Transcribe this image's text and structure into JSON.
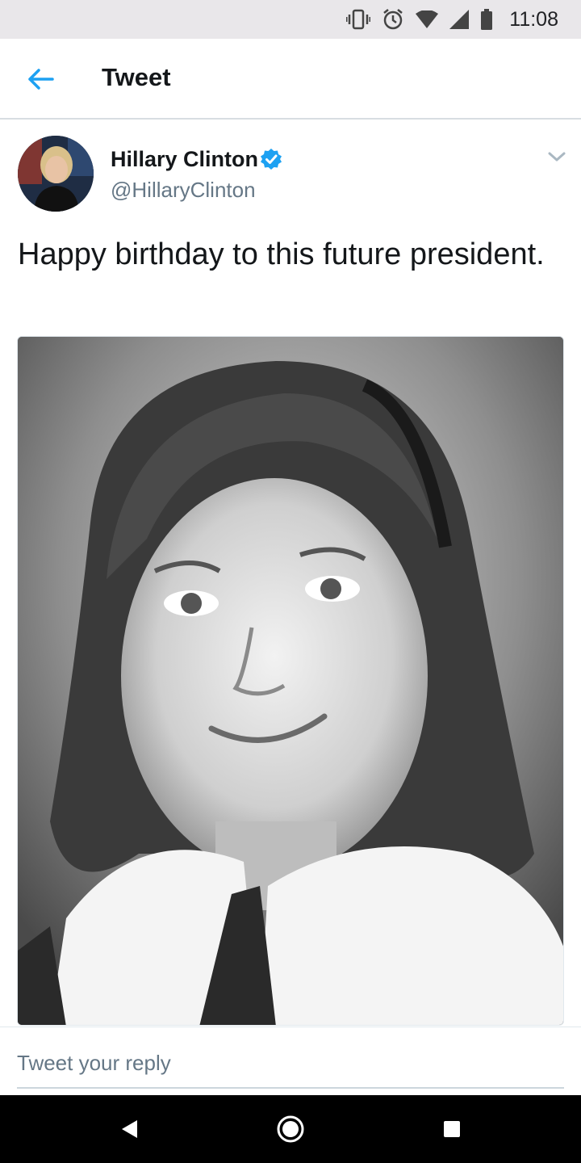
{
  "status_bar": {
    "time": "11:08",
    "icons": [
      "vibrate-icon",
      "alarm-icon",
      "wifi-icon",
      "signal-icon",
      "battery-icon"
    ]
  },
  "app_bar": {
    "back_icon": "arrow-left-icon",
    "title": "Tweet"
  },
  "tweet": {
    "author_name": "Hillary Clinton",
    "author_handle": "@HillaryClinton",
    "verified": true,
    "text": "Happy birthday to this future president.",
    "media": {
      "type": "photo",
      "description_icon": "photo"
    }
  },
  "reply": {
    "placeholder": "Tweet your reply"
  },
  "nav_bar": {
    "icons": [
      "back-triangle-icon",
      "home-circle-icon",
      "recents-square-icon"
    ]
  },
  "colors": {
    "accent": "#1da1f2",
    "text_primary": "#14171a",
    "text_secondary": "#657786",
    "status_bar_bg": "#e9e7ea"
  }
}
